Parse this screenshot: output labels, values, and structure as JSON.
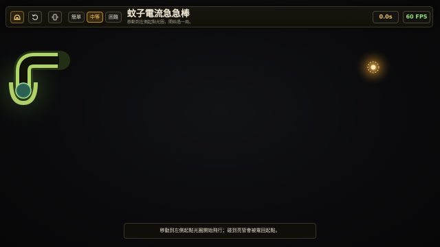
{
  "header": {
    "title": "蚊子電流急急棒",
    "subtitle": "移動到左側起點光圈，開始過一局。",
    "icons": [
      "helmet-icon",
      "restart-icon",
      "vibrate-icon"
    ],
    "difficulty": {
      "options": [
        "簡單",
        "中等",
        "困難"
      ],
      "selected": "中等"
    },
    "timer": "0.0s",
    "fps": "60 FPS"
  },
  "game": {
    "start_ring_color": "#2f6a5a",
    "track_color": "#9bd94a",
    "goal_color": "#f0b040"
  },
  "status": {
    "message": "移動到左側起點光圈開始飛行；碰到亮管會被電回起點。"
  }
}
